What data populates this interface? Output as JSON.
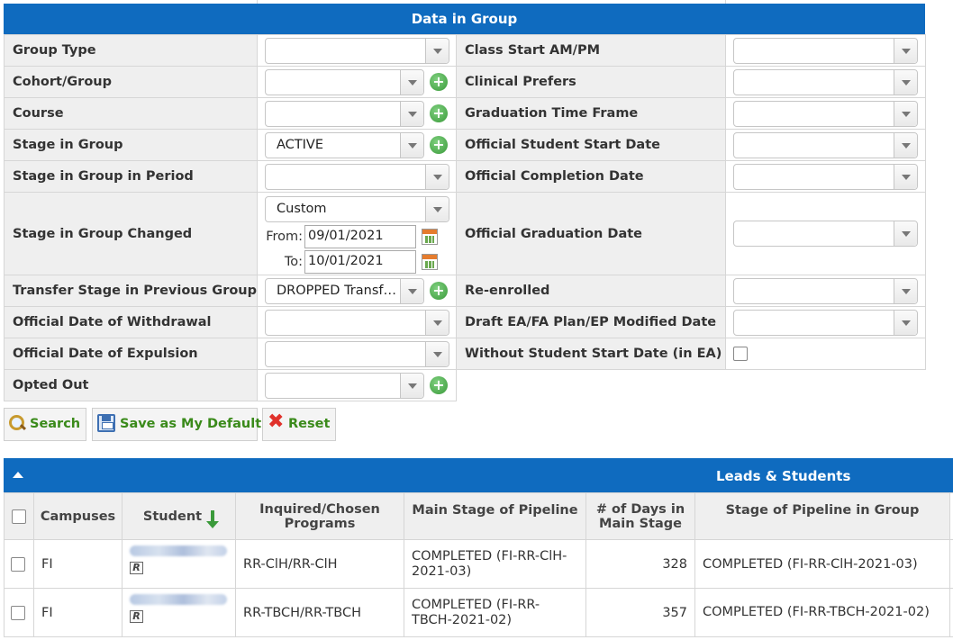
{
  "panel": {
    "title": "Data in Group",
    "rows": [
      {
        "left_label": "Group Type",
        "left_value": "",
        "right_label": "Class Start AM/PM",
        "right_value": ""
      },
      {
        "left_label": "Cohort/Group",
        "left_value": "",
        "right_label": "Clinical Prefers",
        "right_value": ""
      },
      {
        "left_label": "Course",
        "left_value": "",
        "right_label": "Graduation Time Frame",
        "right_value": ""
      },
      {
        "left_label": "Stage in Group",
        "left_value": "ACTIVE",
        "right_label": "Official Student Start Date",
        "right_value": ""
      },
      {
        "left_label": "Stage in Group in Period",
        "left_value": "",
        "right_label": "Official Completion Date",
        "right_value": ""
      },
      {
        "left_label": "Stage in Group Changed",
        "left_value": "Custom",
        "right_label": "Official Graduation Date",
        "right_value": ""
      },
      {
        "left_label": "Transfer Stage in Previous Group",
        "left_value": "DROPPED Transf…",
        "right_label": "Re-enrolled",
        "right_value": ""
      },
      {
        "left_label": "Official Date of Withdrawal",
        "left_value": "",
        "right_label": "Draft EA/FA Plan/EP Modified Date",
        "right_value": ""
      },
      {
        "left_label": "Official Date of Expulsion",
        "left_value": "",
        "right_label": "Without Student Start Date (in EA)",
        "right_value": ""
      },
      {
        "left_label": "Opted Out",
        "left_value": ""
      }
    ],
    "from_label": "From:",
    "from_date": "09/01/2021",
    "to_label": "To:",
    "to_date": "10/01/2021"
  },
  "buttons": {
    "search": "Search",
    "save_default": "Save as My Default",
    "reset": "Reset"
  },
  "grid": {
    "title": "Leads & Students",
    "columns": [
      "Campuses",
      "Student",
      "Inquired/Chosen Programs",
      "Main Stage of Pipeline",
      "# of Days in Main Stage",
      "Stage of Pipeline in Group"
    ],
    "rows": [
      {
        "campus": "FI",
        "programs": "RR-ClH/RR-ClH",
        "main_stage": "COMPLETED (FI-RR-ClH-2021-03)",
        "days": "328",
        "group_stage": "COMPLETED (FI-RR-ClH-2021-03)"
      },
      {
        "campus": "FI",
        "programs": "RR-TBCH/RR-TBCH",
        "main_stage": "COMPLETED (FI-RR-TBCH-2021-02)",
        "days": "357",
        "group_stage": "COMPLETED (FI-RR-TBCH-2021-02)"
      }
    ]
  },
  "icons": {
    "search": "magnifier-icon",
    "save": "floppy-disk-icon",
    "reset": "red-x-icon",
    "add": "green-plus-icon",
    "calendar": "calendar-icon",
    "sort": "sort-down-arrow-icon",
    "collapse": "collapse-caret-icon",
    "record": "r-badge-icon"
  },
  "colors": {
    "header_blue": "#0f6bbf",
    "button_text_green": "#3a8a1a",
    "student_link_blue": "#1468b8"
  }
}
